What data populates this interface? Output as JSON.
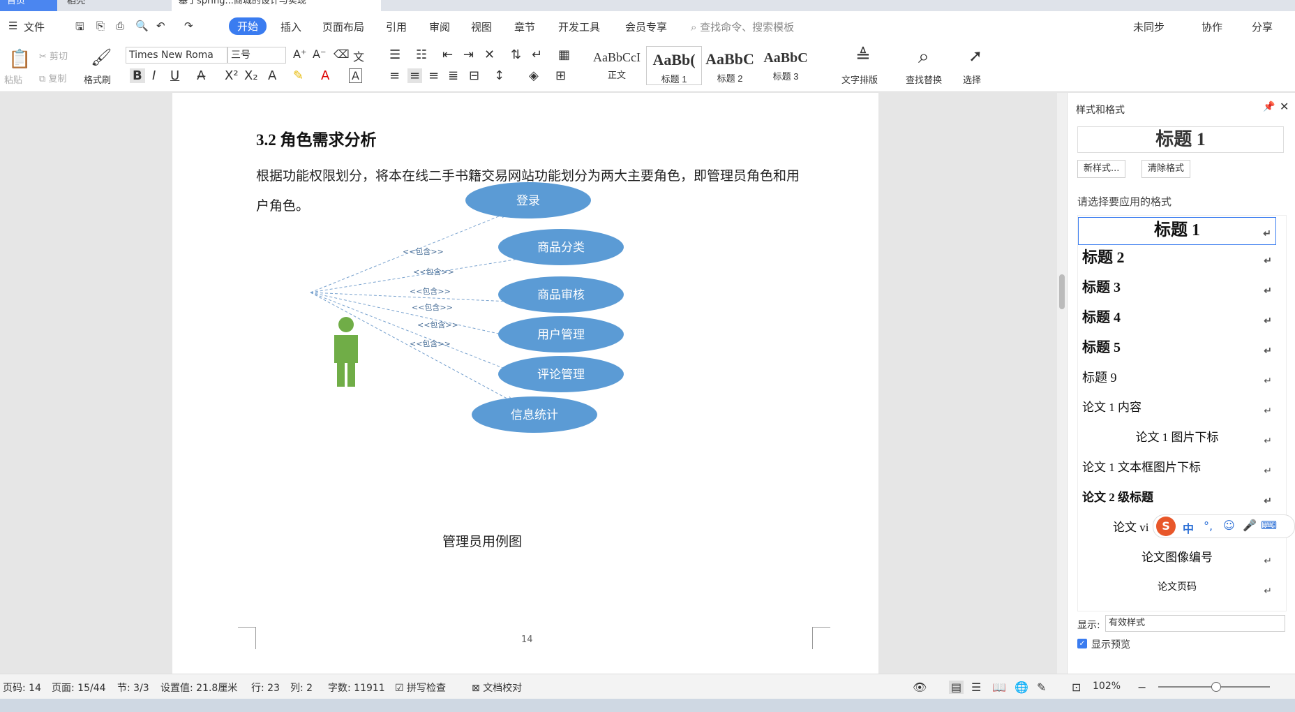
{
  "tabs": {
    "home": "首页",
    "wps": "稻壳",
    "doc": "基于spring...商城的设计与实现"
  },
  "menubar": {
    "file": "文件",
    "items": [
      "开始",
      "插入",
      "页面布局",
      "引用",
      "审阅",
      "视图",
      "章节",
      "开发工具",
      "会员专享"
    ],
    "search_placeholder": "查找命令、搜索模板",
    "sync": "未同步",
    "collab": "协作",
    "share": "分享"
  },
  "ribbon": {
    "paste": "粘贴",
    "cut": "剪切",
    "copy": "复制",
    "format_painter": "格式刷",
    "font_name": "Times New Roma",
    "font_size": "三号",
    "styles": [
      {
        "sample": "AaBbCcI",
        "name": "正文"
      },
      {
        "sample": "AaBb(",
        "name": "标题 1"
      },
      {
        "sample": "AaBbC",
        "name": "标题 2"
      },
      {
        "sample": "AaBbC",
        "name": "标题 3"
      }
    ],
    "text_layout": "文字排版",
    "find_replace": "查找替换",
    "select": "选择"
  },
  "document": {
    "heading": "3.2  角色需求分析",
    "paragraph": "根据功能权限划分，将本在线二手书籍交易网站功能划分为两大主要角色，即管理员角色和用户角色。",
    "caption": "管理员用例图",
    "page_number": "14",
    "diagram": {
      "use_cases": [
        "登录",
        "商品分类",
        "商品审核",
        "用户管理",
        "评论管理",
        "信息统计"
      ],
      "relation_label": "<<包含>>"
    }
  },
  "panel": {
    "title": "样式和格式",
    "current_style": "标题 1",
    "new_style": "新样式...",
    "clear_format": "清除格式",
    "prompt": "请选择要应用的格式",
    "styles": [
      "标题 1",
      "标题 2",
      "标题 3",
      "标题 4",
      "标题 5",
      "标题 9",
      "论文 1 内容",
      "论文 1 图片下标",
      "论文 1 文本框图片下标",
      "论文 2 级标题",
      "论文 vi",
      "论文图像编号",
      "论文页码"
    ],
    "show_label": "显示:",
    "show_value": "有效样式",
    "preview_label": "显示预览"
  },
  "status": {
    "page_code": "页码: 14",
    "page": "页面: 15/44",
    "section": "节: 3/3",
    "setting": "设置值: 21.8厘米",
    "row": "行: 23",
    "col": "列: 2",
    "words": "字数: 11911",
    "spellcheck": "拼写检查",
    "proof": "文档校对",
    "zoom": "102%"
  },
  "ime": {
    "lang": "中"
  },
  "colors": {
    "accent": "#3a7cf0",
    "ellipse": "#5b9bd5",
    "actor": "#70ad47"
  }
}
